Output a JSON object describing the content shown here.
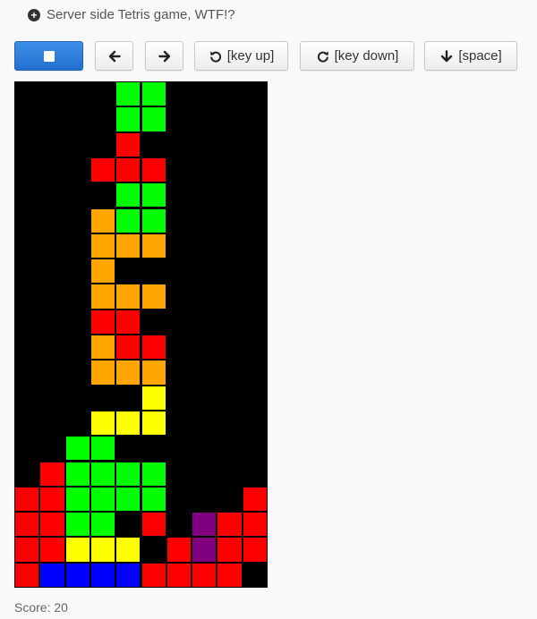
{
  "header": {
    "title": "Server side Tetris game, WTF!?"
  },
  "toolbar": {
    "left_label": "",
    "right_label": "",
    "rotate_ccw_label": "[key up]",
    "rotate_cw_label": "[key down]",
    "drop_label": "[space]"
  },
  "colors": {
    "R": "#ff0000",
    "G": "#00ff00",
    "O": "#ffa500",
    "Y": "#ffff00",
    "B": "#0000ff",
    "P": "#800080",
    "primary_button": "#2f80e0",
    "board_background": "#000000"
  },
  "board": {
    "columns": 10,
    "rows": 20,
    "grid": [
      "....GG....",
      "....GG....",
      "....R.....",
      "...RRR....",
      "....GG....",
      "...OGG....",
      "...OOO....",
      "...O......",
      "...OOO....",
      "...RR.....",
      "...ORR....",
      "...OOO....",
      ".....Y....",
      "...YYY....",
      "..GG......",
      ".RGGGG....",
      "RRGGGG...R",
      "RRGG.R.PRR",
      "RRYYY.RPRR",
      "RBBBBRRRR."
    ]
  },
  "score": {
    "text": "Score: 20"
  }
}
